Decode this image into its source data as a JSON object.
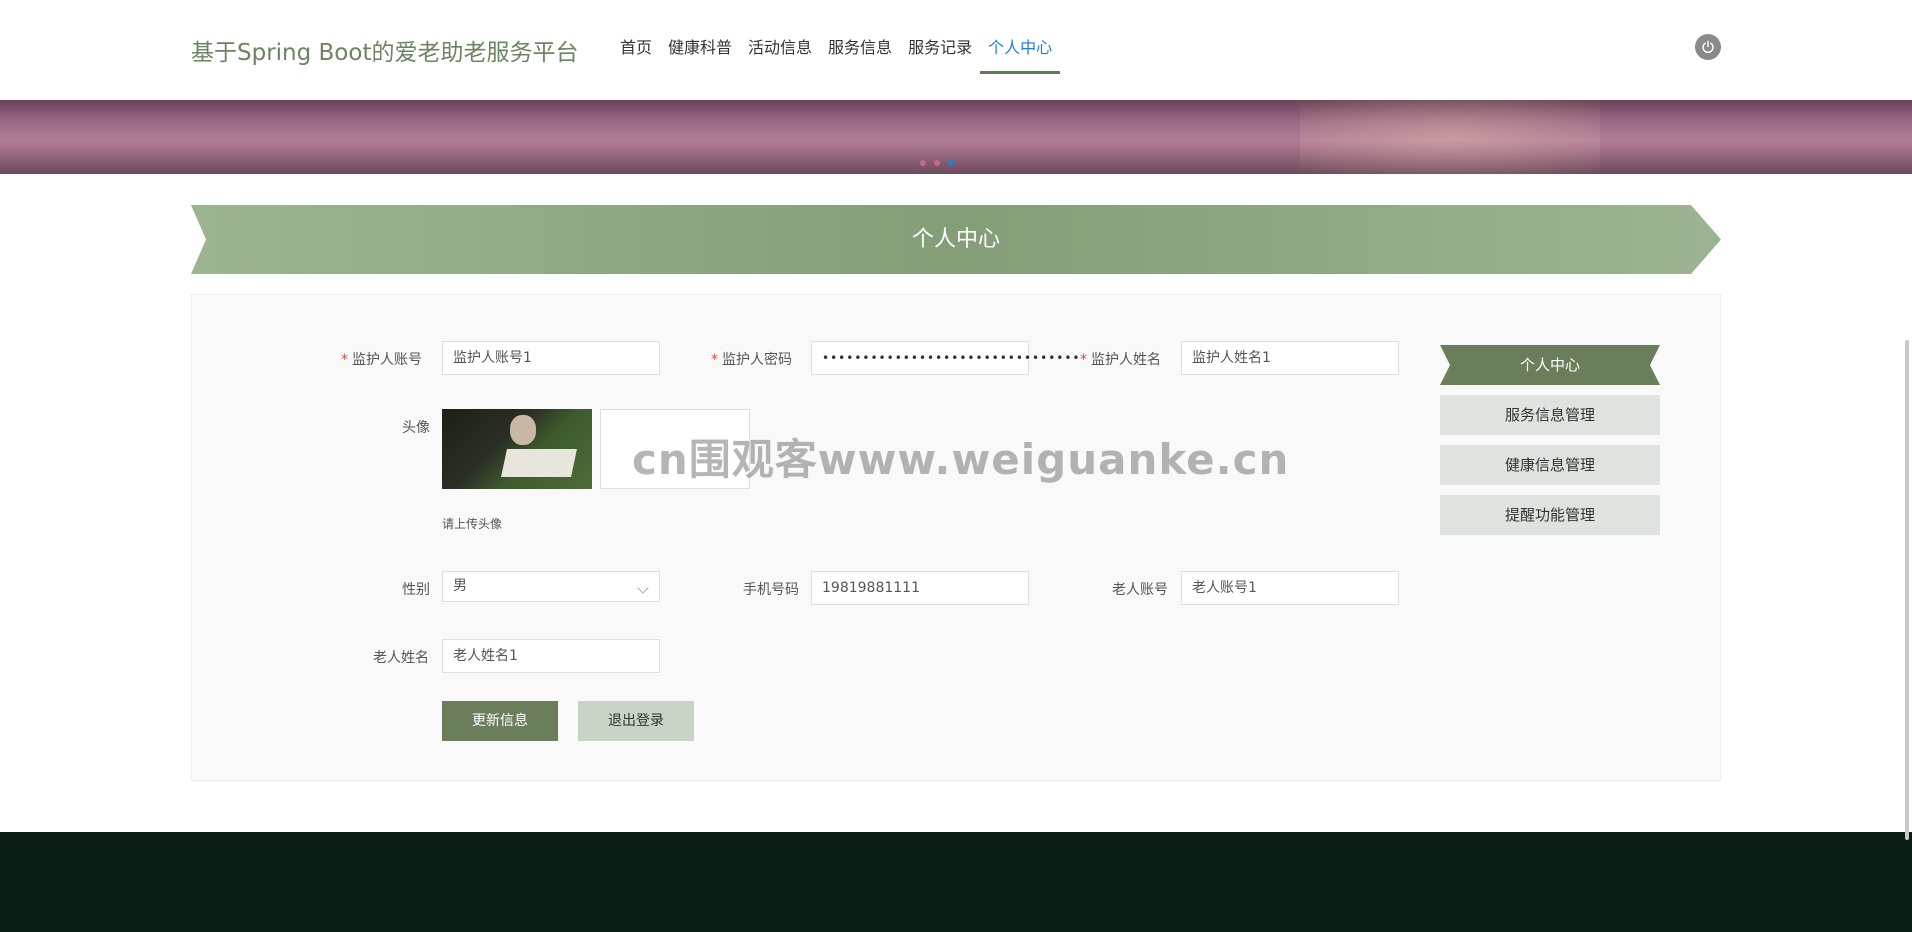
{
  "header": {
    "site_title": "基于Spring Boot的爱老助老服务平台",
    "nav": [
      {
        "label": "首页"
      },
      {
        "label": "健康科普"
      },
      {
        "label": "活动信息"
      },
      {
        "label": "服务信息"
      },
      {
        "label": "服务记录"
      },
      {
        "label": "个人中心"
      }
    ],
    "active_nav": "个人中心",
    "power_icon": "power-icon"
  },
  "banner": {
    "dots": 3,
    "active_dot": 3
  },
  "section": {
    "title": "个人中心"
  },
  "form": {
    "guardian_account": {
      "label": "监护人账号",
      "value": "监护人账号1",
      "required": true
    },
    "guardian_password": {
      "label": "监护人密码",
      "value": "••••••••••••••••••••••••••••••••",
      "required": true
    },
    "guardian_name": {
      "label": "监护人姓名",
      "value": "监护人姓名1",
      "required": true
    },
    "avatar": {
      "label": "头像",
      "hint": "请上传头像"
    },
    "gender": {
      "label": "性别",
      "value": "男"
    },
    "phone": {
      "label": "手机号码",
      "value": "19819881111"
    },
    "elder_account": {
      "label": "老人账号",
      "value": "老人账号1"
    },
    "elder_name": {
      "label": "老人姓名",
      "value": "老人姓名1"
    },
    "update_button": "更新信息",
    "logout_button": "退出登录"
  },
  "side_menu": [
    {
      "label": "个人中心",
      "active": true
    },
    {
      "label": "服务信息管理"
    },
    {
      "label": "健康信息管理"
    },
    {
      "label": "提醒功能管理"
    }
  ],
  "watermark": "cn围观客www.weiguanke.cn",
  "colors": {
    "brand_green": "#6b7e5b",
    "title_green": "#6b8462",
    "active_nav": "#1e7ed8",
    "footer": "#0b1e16",
    "required": "#e2483b"
  }
}
